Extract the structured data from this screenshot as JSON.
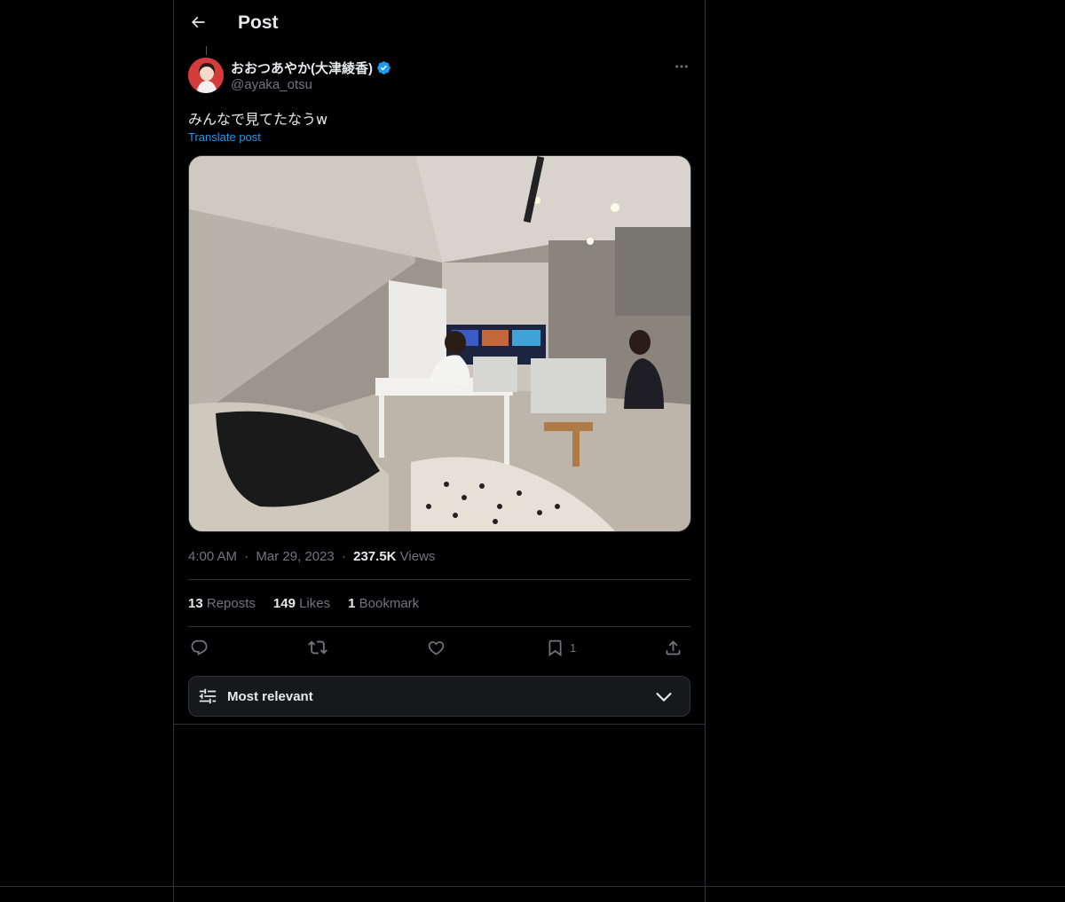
{
  "header": {
    "title": "Post"
  },
  "author": {
    "display_name": "おおつあやか(大津綾香)",
    "handle": "@ayaka_otsu",
    "verified": true
  },
  "tweet": {
    "text": "みんなで見てたなうw",
    "translate_label": "Translate post"
  },
  "meta": {
    "time": "4:00 AM",
    "separator": "·",
    "date": "Mar 29, 2023",
    "views_count": "237.5K",
    "views_label": "Views"
  },
  "stats": {
    "reposts_count": "13",
    "reposts_label": "Reposts",
    "likes_count": "149",
    "likes_label": "Likes",
    "bookmarks_count": "1",
    "bookmarks_label": "Bookmark"
  },
  "actions": {
    "bookmark_count": "1"
  },
  "sort": {
    "label": "Most relevant"
  },
  "colors": {
    "background": "#000000",
    "text": "#e7e9ea",
    "muted": "#71767b",
    "accent": "#1d9bf0",
    "border": "#2f3336"
  },
  "icons": [
    "back-arrow-icon",
    "verified-badge-icon",
    "more-icon",
    "reply-icon",
    "repost-icon",
    "like-icon",
    "bookmark-icon",
    "share-icon",
    "sliders-icon",
    "chevron-down-icon"
  ]
}
